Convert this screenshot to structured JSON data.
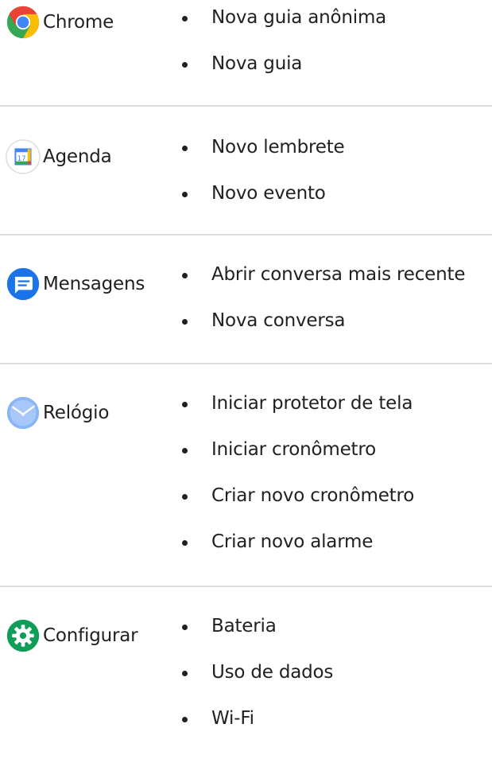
{
  "rows": [
    {
      "app": {
        "name": "Chrome",
        "icon": "chrome-icon"
      },
      "shortcuts": [
        "Nova guia anônima",
        "Nova guia"
      ]
    },
    {
      "app": {
        "name": "Agenda",
        "icon": "calendar-icon",
        "icon_text": "17"
      },
      "shortcuts": [
        "Novo lembrete",
        "Novo evento"
      ]
    },
    {
      "app": {
        "name": "Mensagens",
        "icon": "messages-icon"
      },
      "shortcuts": [
        "Abrir conversa mais recente",
        "Nova conversa"
      ]
    },
    {
      "app": {
        "name": "Relógio",
        "icon": "clock-icon"
      },
      "shortcuts": [
        "Iniciar protetor de tela",
        "Iniciar cronômetro",
        "Criar novo cronômetro",
        "Criar novo alarme"
      ]
    },
    {
      "app": {
        "name": "Configurar",
        "icon": "settings-gear-icon"
      },
      "shortcuts": [
        "Bateria",
        "Uso de dados",
        "Wi-Fi"
      ]
    }
  ],
  "colors": {
    "divider": "#dadce0",
    "text": "#202124",
    "chrome_red": "#ea4335",
    "chrome_yellow": "#fbbc04",
    "chrome_green": "#34a853",
    "chrome_blue": "#4285f4",
    "messages_blue": "#1a73e8",
    "clock_blue": "#8ab4f8",
    "settings_green": "#0f9d58"
  }
}
